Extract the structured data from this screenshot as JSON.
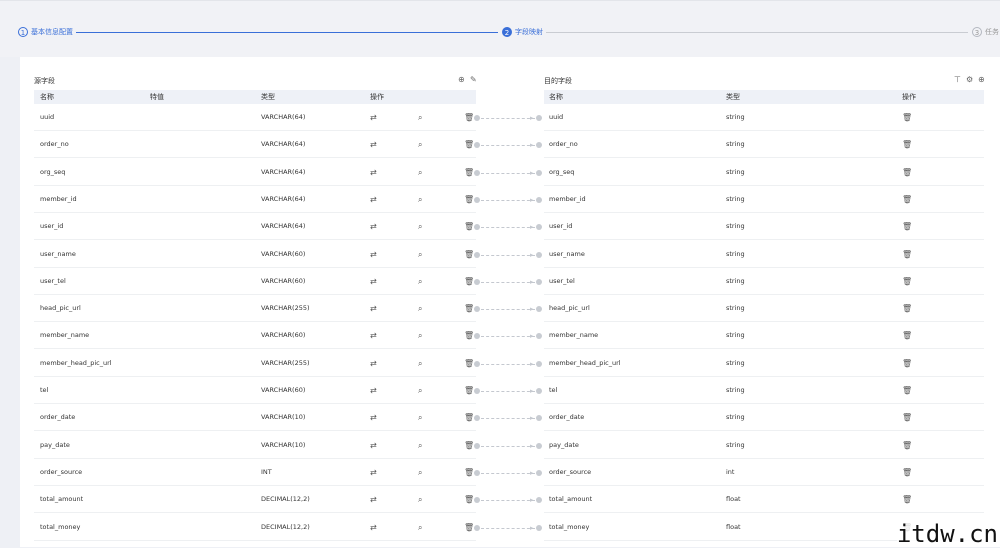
{
  "steps": [
    {
      "num": "1",
      "label": "基本信息配置"
    },
    {
      "num": "2",
      "label": "字段映射"
    },
    {
      "num": "3",
      "label": "任务"
    }
  ],
  "source": {
    "title": "源字段",
    "headers": {
      "name": "名称",
      "feature": "特值",
      "type": "类型",
      "action": "操作"
    }
  },
  "target": {
    "title": "目的字段",
    "headers": {
      "name": "名称",
      "type": "类型",
      "action": "操作"
    }
  },
  "source_rows": [
    {
      "name": "uuid",
      "type": "VARCHAR(64)"
    },
    {
      "name": "order_no",
      "type": "VARCHAR(64)"
    },
    {
      "name": "org_seq",
      "type": "VARCHAR(64)"
    },
    {
      "name": "member_id",
      "type": "VARCHAR(64)"
    },
    {
      "name": "user_id",
      "type": "VARCHAR(64)"
    },
    {
      "name": "user_name",
      "type": "VARCHAR(60)"
    },
    {
      "name": "user_tel",
      "type": "VARCHAR(60)"
    },
    {
      "name": "head_pic_url",
      "type": "VARCHAR(255)"
    },
    {
      "name": "member_name",
      "type": "VARCHAR(60)"
    },
    {
      "name": "member_head_pic_url",
      "type": "VARCHAR(255)"
    },
    {
      "name": "tel",
      "type": "VARCHAR(60)"
    },
    {
      "name": "order_date",
      "type": "VARCHAR(10)"
    },
    {
      "name": "pay_date",
      "type": "VARCHAR(10)"
    },
    {
      "name": "order_source",
      "type": "INT"
    },
    {
      "name": "total_amount",
      "type": "DECIMAL(12,2)"
    },
    {
      "name": "total_money",
      "type": "DECIMAL(12,2)"
    }
  ],
  "target_rows": [
    {
      "name": "uuid",
      "type": "string"
    },
    {
      "name": "order_no",
      "type": "string"
    },
    {
      "name": "org_seq",
      "type": "string"
    },
    {
      "name": "member_id",
      "type": "string"
    },
    {
      "name": "user_id",
      "type": "string"
    },
    {
      "name": "user_name",
      "type": "string"
    },
    {
      "name": "user_tel",
      "type": "string"
    },
    {
      "name": "head_pic_url",
      "type": "string"
    },
    {
      "name": "member_name",
      "type": "string"
    },
    {
      "name": "member_head_pic_url",
      "type": "string"
    },
    {
      "name": "tel",
      "type": "string"
    },
    {
      "name": "order_date",
      "type": "string"
    },
    {
      "name": "pay_date",
      "type": "string"
    },
    {
      "name": "order_source",
      "type": "int"
    },
    {
      "name": "total_amount",
      "type": "float"
    },
    {
      "name": "total_money",
      "type": "float"
    }
  ],
  "icons": {
    "refresh": "⇄",
    "search": "⌕",
    "trash": "🗑",
    "add": "⊕",
    "edit": "✎",
    "settings": "⚙",
    "filter": "⊤"
  },
  "colors": {
    "accent": "#3a6fd8",
    "header_bg": "#eef1f7",
    "page_bg": "#eef0f5"
  },
  "watermark": "itdw.cn"
}
